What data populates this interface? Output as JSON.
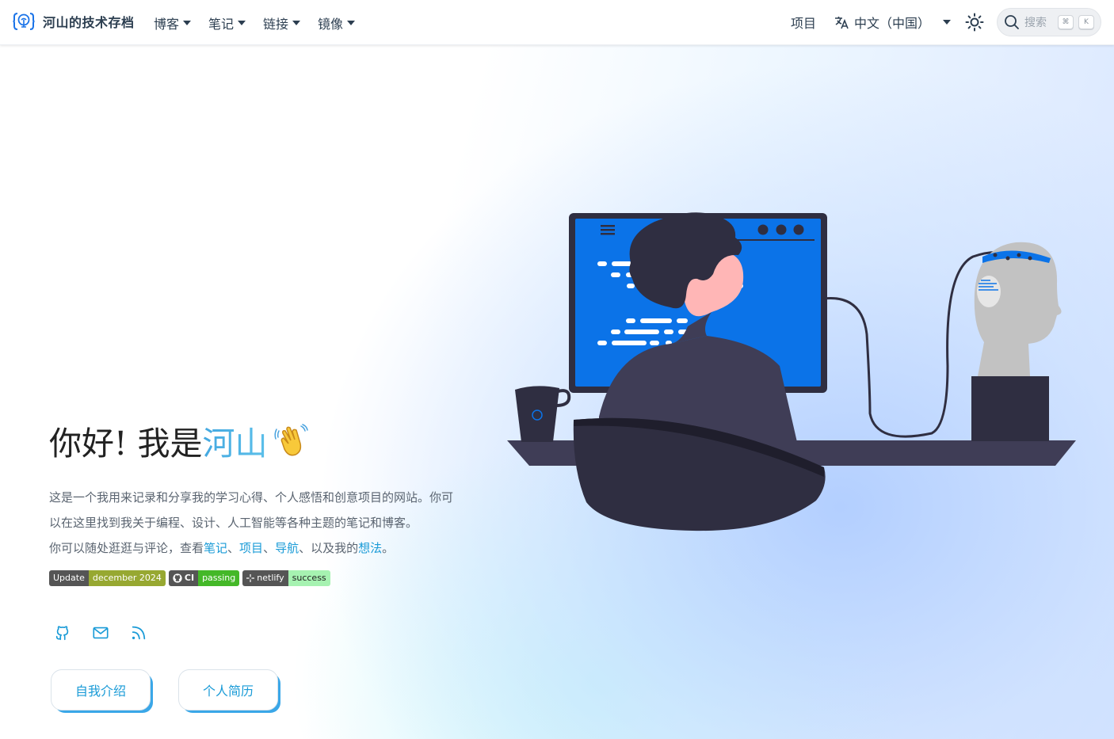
{
  "navbar": {
    "site_title": "河山的技术存档",
    "menus": [
      {
        "label": "博客"
      },
      {
        "label": "笔记"
      },
      {
        "label": "链接"
      },
      {
        "label": "镜像"
      }
    ],
    "projects_link": "项目",
    "language": "中文（中国）",
    "search_placeholder": "搜索",
    "search_keys": [
      "⌘",
      "K"
    ]
  },
  "hero": {
    "title_prefix": "你好! 我是",
    "title_name": "河山",
    "desc_line1": "这是一个我用来记录和分享我的学习心得、个人感悟和创意项目的网站。你可以在这里找到我关于编程、设计、人工智能等各种主题的笔记和博客。",
    "desc_line2_prefix": "你可以随处逛逛与评论，查看",
    "link_notes": "笔记",
    "sep1": "、",
    "link_projects": "项目",
    "sep2": "、",
    "link_nav": "导航",
    "desc_line2_mid": "、以及我的",
    "link_thoughts": "想法",
    "desc_line2_end": "。"
  },
  "badges": [
    {
      "label": "Update",
      "value": "december 2024",
      "color": "#97a831"
    },
    {
      "label": "CI",
      "value": "passing",
      "color": "#44b828"
    },
    {
      "label": "netlify",
      "value": "success",
      "color": "#a6f2b1",
      "value_text_color": "#222"
    }
  ],
  "social": [
    "github-icon",
    "mail-icon",
    "rss-icon"
  ],
  "buttons": {
    "about": "自我介绍",
    "resume": "个人简历"
  },
  "colors": {
    "accent": "#1a9bd7",
    "brand_blue": "#1a73e8",
    "screen_blue": "#0b73e8",
    "dark": "#2f2e41"
  }
}
